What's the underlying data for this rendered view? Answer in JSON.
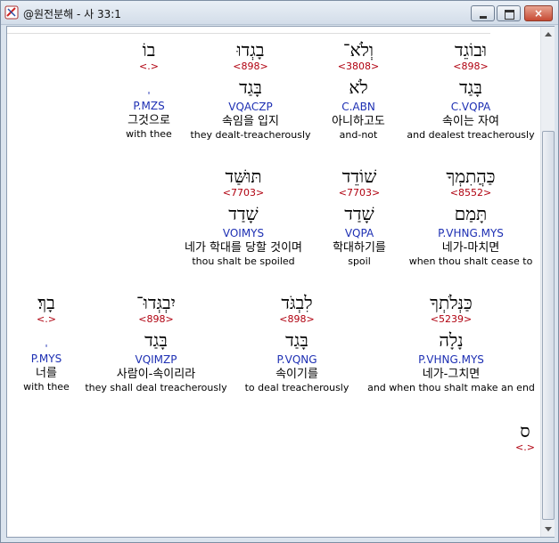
{
  "window": {
    "title": "@원전분해 - 사 33:1",
    "close_label": "×"
  },
  "rows": [
    {
      "words": [
        {
          "heb": "וּבוֹגֵד",
          "strong": "<898>",
          "lemma": "בָּגַד",
          "morph": "C.VQPA",
          "kor": "속이는 자여",
          "eng": "and dealest treacherously",
          "tick": ""
        },
        {
          "heb": "וְלֹא־",
          "strong": "<3808>",
          "lemma": "לֹא",
          "morph": "C.ABN",
          "kor": "아니하고도",
          "eng": "and-not",
          "tick": ""
        },
        {
          "heb": "בָגְדוּ",
          "strong": "<898>",
          "lemma": "בָּגַד",
          "morph": "VQACZP",
          "kor": "속임을 입지",
          "eng": "they dealt-treacherously",
          "tick": ""
        },
        {
          "heb": "בוֹ",
          "strong": "<.>",
          "lemma": "",
          "morph": "P.MZS",
          "kor": "그것으로",
          "eng": "with thee",
          "tick": "'"
        }
      ]
    },
    {
      "words": [
        {
          "heb": "כַּהֲתִמְךָ",
          "strong": "<8552>",
          "lemma": "תָּמַם",
          "morph": "P.VHNG.MYS",
          "kor": "네가-마치면",
          "eng": "when thou shalt cease to",
          "tick": ""
        },
        {
          "heb": "שׁוֹדֵד",
          "strong": "<7703>",
          "lemma": "שָׁדַד",
          "morph": "VQPA",
          "kor": "학대하기를",
          "eng": "spoil",
          "tick": ""
        },
        {
          "heb": "תּוּשַּׁד",
          "strong": "<7703>",
          "lemma": "שָׁדַד",
          "morph": "VOIMYS",
          "kor": "네가 학대를 당할 것이며",
          "eng": "thou shalt be spoiled",
          "tick": ""
        }
      ]
    },
    {
      "words": [
        {
          "heb": "כַּנְּלֹתְךָ",
          "strong": "<5239>",
          "lemma": "נָלָה",
          "morph": "P.VHNG.MYS",
          "kor": "네가-그치면",
          "eng": "and when thou shalt make an end",
          "tick": ""
        },
        {
          "heb": "לִבְגֹּד",
          "strong": "<898>",
          "lemma": "בָּגַד",
          "morph": "P.VQNG",
          "kor": "속이기를",
          "eng": "to deal treacherously",
          "tick": ""
        },
        {
          "heb": "יִבְגְּדוּ־",
          "strong": "<898>",
          "lemma": "בָּגַד",
          "morph": "VQIMZP",
          "kor": "사람이-속이리라",
          "eng": "they shall deal treacherously",
          "tick": ""
        },
        {
          "heb": "בָךְ׃",
          "strong": "<.>",
          "lemma": "",
          "morph": "P.MYS",
          "kor": "너를",
          "eng": "with thee",
          "tick": "'"
        }
      ]
    },
    {
      "words": [
        {
          "heb": "ס",
          "strong": "<.>",
          "lemma": "",
          "morph": "",
          "kor": "",
          "eng": "",
          "tick": ""
        }
      ]
    }
  ]
}
